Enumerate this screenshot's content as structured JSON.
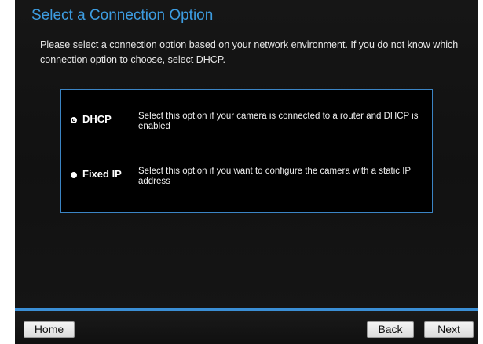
{
  "page": {
    "title": "Select a Connection Option",
    "intro": "Please select a connection option based on your network environment. If you do not know which connection option to choose, select DHCP."
  },
  "options": [
    {
      "label": "DHCP",
      "description": "Select this option if your camera is connected to a router and DHCP is enabled",
      "selected": true
    },
    {
      "label": "Fixed IP",
      "description": "Select this option if you want to configure the camera with a static IP address",
      "selected": false
    }
  ],
  "buttons": {
    "home": "Home",
    "back": "Back",
    "next": "Next"
  },
  "colors": {
    "title": "#3d9ce0",
    "accent_bar": "#3b8fd6",
    "options_border": "#3b84c4",
    "panel_background": "#111111"
  }
}
